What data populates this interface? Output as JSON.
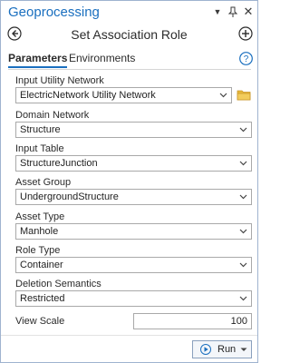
{
  "app": {
    "title": "Geoprocessing"
  },
  "tool": {
    "title": "Set Association Role"
  },
  "tabs": [
    {
      "label": "Parameters",
      "active": true
    },
    {
      "label": "Environments",
      "active": false
    }
  ],
  "params": [
    {
      "label": "Input Utility Network",
      "value": "ElectricNetwork Utility Network"
    },
    {
      "label": "Domain Network",
      "value": "Structure"
    },
    {
      "label": "Input Table",
      "value": "StructureJunction"
    },
    {
      "label": "Asset Group",
      "value": "UndergroundStructure"
    },
    {
      "label": "Asset Type",
      "value": "Manhole"
    },
    {
      "label": "Role Type",
      "value": "Container"
    },
    {
      "label": "Deletion Semantics",
      "value": "Restricted"
    }
  ],
  "view_scale": {
    "label": "View Scale",
    "value": "100"
  },
  "run": {
    "label": "Run"
  },
  "colors": {
    "accent": "#1a6fbf",
    "folder": "#e8b93a"
  },
  "icons": [
    "chevron-down-icon",
    "pin-icon",
    "close-icon",
    "back-arrow-icon",
    "add-circle-icon",
    "help-icon",
    "folder-icon",
    "play-icon"
  ]
}
